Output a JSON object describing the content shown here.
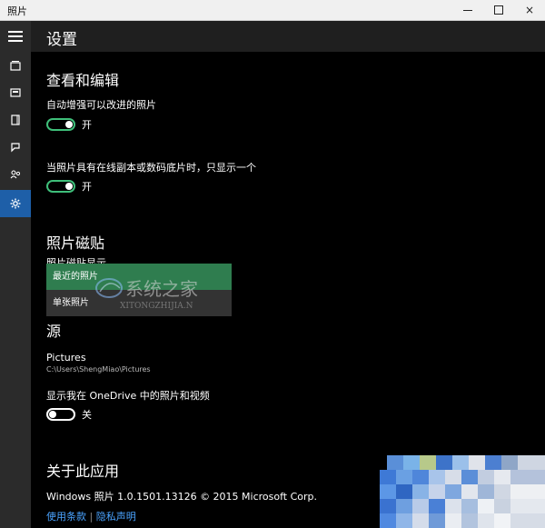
{
  "window": {
    "title": "照片",
    "min_label": "",
    "max_label": "",
    "close_label": "×"
  },
  "header": {
    "title": "设置"
  },
  "rail": {
    "items": [
      {
        "icon": "hamburger-icon"
      },
      {
        "icon": "collection-icon"
      },
      {
        "icon": "album-icon"
      },
      {
        "icon": "folder-icon"
      },
      {
        "icon": "story-remix-icon"
      },
      {
        "icon": "people-icon"
      },
      {
        "icon": "gear-icon",
        "active": true
      }
    ]
  },
  "view_edit": {
    "heading": "查看和编辑",
    "auto_enhance_label": "自动增强可以改进的照片",
    "auto_enhance_state": "开",
    "duplicates_label": "当照片具有在线副本或数码底片时，只显示一个",
    "duplicates_state": "开"
  },
  "tile": {
    "heading": "照片磁贴",
    "partial_label": "照片磁贴显示",
    "options": [
      "最近的照片",
      "单张照片"
    ],
    "selected": "最近的照片"
  },
  "sources": {
    "heading": "源",
    "folder_name": "Pictures",
    "folder_path": "C:\\Users\\ShengMiao\\Pictures",
    "onedrive_label": "显示我在 OneDrive 中的照片和视频",
    "onedrive_state": "关"
  },
  "about": {
    "heading": "关于此应用",
    "version": "Windows 照片 1.0.1501.13126 © 2015 Microsoft Corp.",
    "terms_link": "使用条款",
    "separator": "|",
    "privacy_link": "隐私声明"
  },
  "watermark": {
    "text_cn": "系统之家",
    "text_en": "XITONGZHIJIA.N"
  },
  "colors": {
    "accent_blue": "#1e5fa8",
    "toggle_green": "#3fbf7a",
    "selected_green": "#2f7d4f",
    "link_blue": "#4aa3ff"
  }
}
